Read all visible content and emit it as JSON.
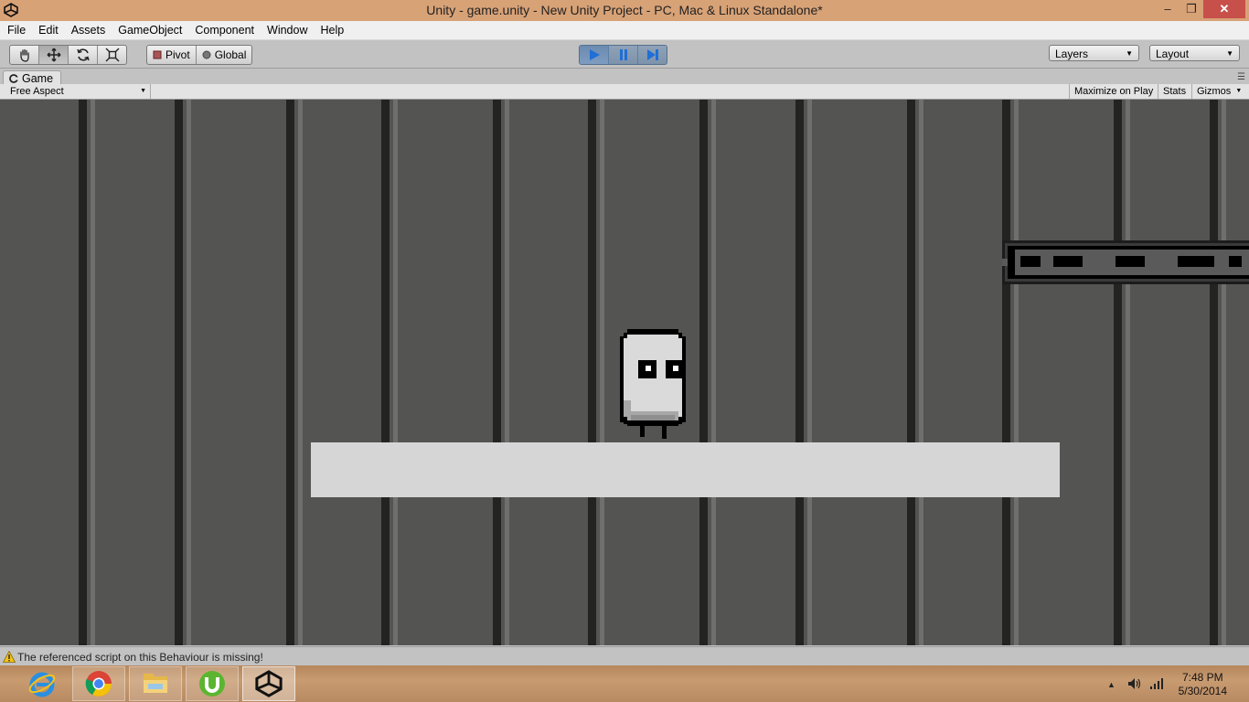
{
  "window": {
    "title": "Unity - game.unity - New Unity Project - PC, Mac & Linux Standalone*",
    "minimize": "–",
    "maximize": "❐",
    "close": "✕"
  },
  "menu": [
    "File",
    "Edit",
    "Assets",
    "GameObject",
    "Component",
    "Window",
    "Help"
  ],
  "toolbar": {
    "transform_tools": [
      "hand-icon",
      "move-icon",
      "rotate-icon",
      "scale-icon"
    ],
    "active_tool": "move-icon",
    "pivot_label": "Pivot",
    "global_label": "Global",
    "play_controls": [
      "play-icon",
      "pause-icon",
      "step-icon"
    ],
    "layers_label": "Layers",
    "layout_label": "Layout"
  },
  "game_panel": {
    "tab_label": "Game",
    "aspect_label": "Free Aspect",
    "maximize_on_play": "Maximize on Play",
    "stats": "Stats",
    "gizmos": "Gizmos"
  },
  "scene": {
    "background_color": "#545553",
    "platform_color": "#d6d6d6",
    "character_color": "#d9d9d9"
  },
  "status": {
    "message": "The referenced script on this Behaviour is missing!",
    "icon": "warning-icon"
  },
  "taskbar": {
    "apps": [
      "internet-explorer-icon",
      "chrome-icon",
      "file-explorer-icon",
      "utorrent-icon",
      "unity-icon"
    ],
    "time": "7:48 PM",
    "date": "5/30/2014"
  }
}
